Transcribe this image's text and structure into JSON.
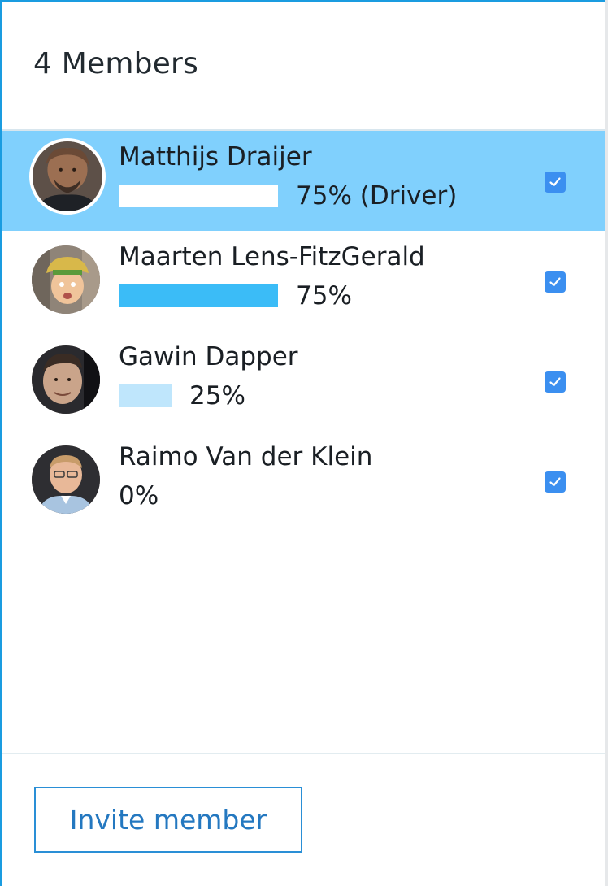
{
  "panel": {
    "title": "4 Members",
    "accent_color": "#1a9ce0",
    "selected_row_color": "#80d0fd"
  },
  "members": [
    {
      "name": "Matthijs Draijer",
      "share_label": "75% (Driver)",
      "share_fraction": 0.75,
      "bar_color": "#ffffff",
      "checked": true,
      "selected": true,
      "avatar_icon": "avatar-photo-matthijs"
    },
    {
      "name": "Maarten Lens-FitzGerald",
      "share_label": "75%",
      "share_fraction": 0.75,
      "bar_color": "#3bbcf7",
      "checked": true,
      "selected": false,
      "avatar_icon": "avatar-photo-maarten"
    },
    {
      "name": "Gawin Dapper",
      "share_label": "25%",
      "share_fraction": 0.25,
      "bar_color": "#bfe6fc",
      "checked": true,
      "selected": false,
      "avatar_icon": "avatar-photo-gawin"
    },
    {
      "name": "Raimo Van der Klein",
      "share_label": "0%",
      "share_fraction": 0,
      "bar_color": "#bfe6fc",
      "checked": true,
      "selected": false,
      "avatar_icon": "avatar-photo-raimo"
    }
  ],
  "footer": {
    "invite_label": "Invite member",
    "button_color": "#2a8fd6"
  }
}
